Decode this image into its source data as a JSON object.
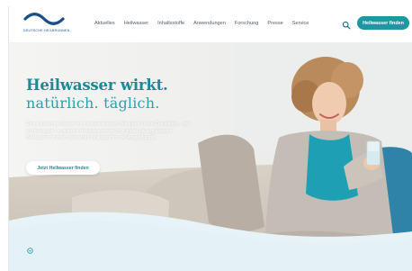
{
  "header": {
    "logo_text": "DEUTSCHE HEILBRUNNEN",
    "nav": [
      "Aktuelles",
      "Heilwasser",
      "Inhaltsstoffe",
      "Anwendungen",
      "Forschung",
      "Presse",
      "Service"
    ],
    "search_icon": "search-icon",
    "cta_label": "Heilwasser finden"
  },
  "hero": {
    "headline": "Heilwasser wirkt.",
    "subline": "natürlich. täglich.",
    "intro": "Rein natürliches Wasser mit nachgewiesenen Wirkungen für die Gesundheit – das ist Heilwasser. In unserem Heilwasserverzeichnis finden Sie zugelassene Heilwasser mit ihren wirksamen Inhaltsstoffen und Anwendungen.",
    "cta_label": "Jetzt Heilwasser finden",
    "scroll_icon": "chevron-circle-icon"
  },
  "colors": {
    "accent": "#1d97a2",
    "headline": "#178c97",
    "logo": "#1b4f8a",
    "nav_text": "#53616b"
  }
}
